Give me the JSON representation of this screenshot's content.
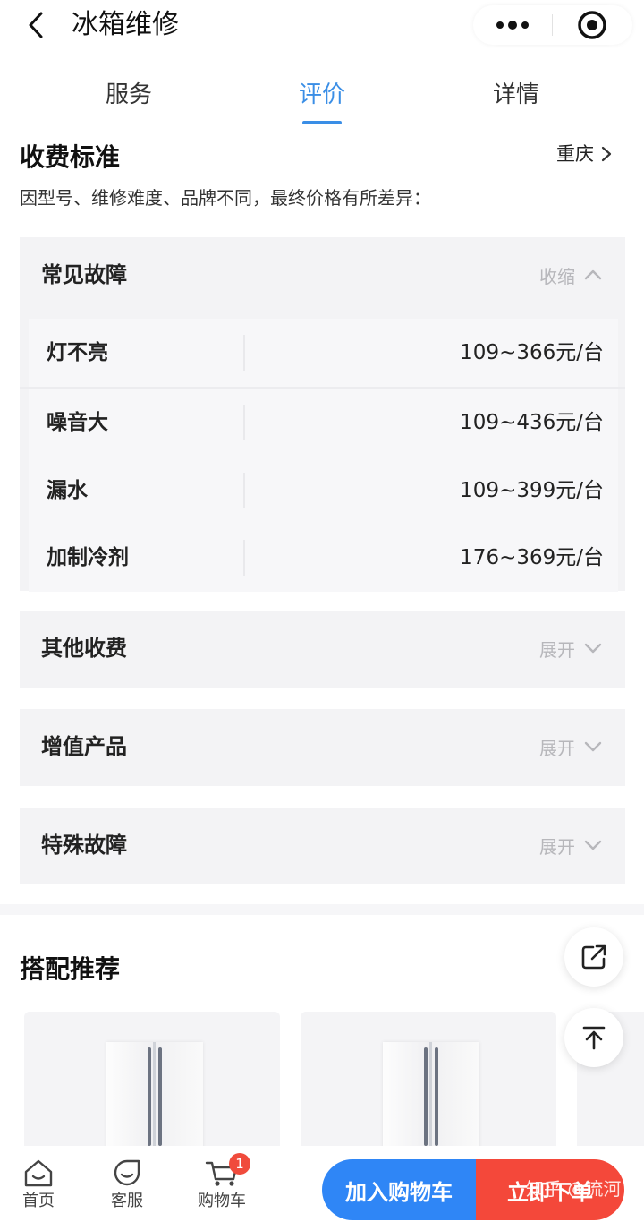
{
  "navbar": {
    "title": "冰箱维修"
  },
  "tabs": [
    "服务",
    "评价",
    "详情"
  ],
  "active_tab": "评价",
  "pricing": {
    "title": "收费标准",
    "city": "重庆",
    "note": "因型号、维修难度、品牌不同，最终价格有所差异：",
    "expanded_group": {
      "label": "常见故障",
      "toggle": "收缩",
      "items": [
        {
          "name": "灯不亮",
          "price": "109~366元/台"
        },
        {
          "name": "噪音大",
          "price": "109~436元/台"
        },
        {
          "name": "漏水",
          "price": "109~399元/台"
        },
        {
          "name": "加制冷剂",
          "price": "176~369元/台"
        }
      ]
    },
    "collapsed_groups": [
      {
        "label": "其他收费",
        "toggle": "展开"
      },
      {
        "label": "增值产品",
        "toggle": "展开"
      },
      {
        "label": "特殊故障",
        "toggle": "展开"
      }
    ]
  },
  "recommend": {
    "title": "搭配推荐"
  },
  "bottom_bar": {
    "items": [
      {
        "label": "首页",
        "icon": "home-icon"
      },
      {
        "label": "客服",
        "icon": "customer-service-icon"
      },
      {
        "label": "购物车",
        "icon": "cart-icon"
      }
    ],
    "cart_badge": "1",
    "add_to_cart": "加入购物车",
    "order_now": "立即下单"
  },
  "watermark": "知乎 @流河",
  "colors": {
    "accent": "#3a8ee6",
    "cart_button": "#2f86f6",
    "order_button": "#f4483a",
    "badge": "#f04b3c"
  }
}
